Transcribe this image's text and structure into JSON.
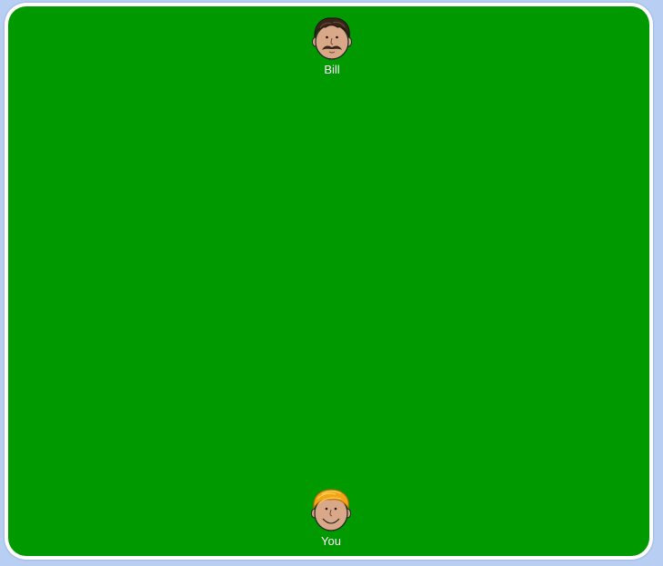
{
  "colors": {
    "background": "#b8cff3",
    "table_felt": "#009a00",
    "frame": "#ffffff",
    "name_text": "#ffffff"
  },
  "players": {
    "opponent": {
      "name": "Bill",
      "avatar": "dark-haired-mustache-avatar"
    },
    "you": {
      "name": "You",
      "avatar": "blond-smiling-avatar"
    }
  }
}
